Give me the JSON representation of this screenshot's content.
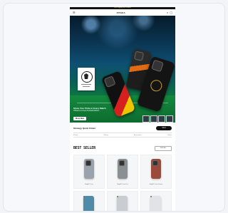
{
  "announcement": "Free shipping on all orders",
  "header": {
    "brand": "PITAKA",
    "icons": [
      "menu-icon",
      "search-icon",
      "account-icon",
      "cart-icon"
    ]
  },
  "hero": {
    "title": "Show Your Pride in Every Match",
    "subtitle": "Official Licensed Football Edition",
    "cta": "Shop Now",
    "thumb_count": 4
  },
  "finder": {
    "title": "Strategy Quick Finder",
    "button": "Find",
    "tabs": [
      "iPhone",
      "Galaxy",
      "Accessories",
      "Others"
    ]
  },
  "bestseller": {
    "title": "BEST SELLER",
    "view_all": "VIEW ALL",
    "products_row1": [
      {
        "name": "MagEZ Case",
        "color": "#9aa3ab"
      },
      {
        "name": "MagEZ Case Pro",
        "color": "#8a8f94"
      },
      {
        "name": "MagEZ Case Sunset",
        "color": "#9b4a3a"
      }
    ],
    "products_row2": [
      {
        "color": "#4f8aa8"
      },
      {
        "color": "#c9ccd0"
      },
      {
        "color": "#e1e3e6"
      }
    ]
  },
  "colors": {
    "hero_bg": "#0b3552",
    "accent": "#111111"
  }
}
